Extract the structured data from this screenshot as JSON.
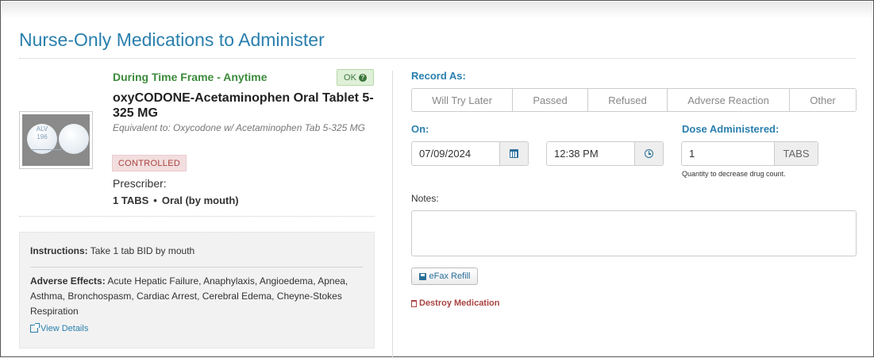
{
  "page": {
    "title": "Nurse-Only Medications to Administer"
  },
  "medication": {
    "image_alt": "pill-image",
    "pill_imprint": "ALV 196",
    "time_frame": "During Time Frame - Anytime",
    "status_badge": "OK",
    "name": "oxyCODONE-Acetaminophen Oral Tablet 5-325 MG",
    "equivalent": "Equivalent to: Oxycodone w/ Acetaminophen Tab 5-325 MG",
    "controlled_label": "CONTROLLED",
    "prescriber_label": "Prescriber:",
    "dose_qty": "1 TABS",
    "dose_separator": "•",
    "route": "Oral (by mouth)"
  },
  "instructions": {
    "label": "Instructions:",
    "text": "Take 1 tab BID by mouth",
    "adverse_label": "Adverse Effects:",
    "adverse_text": "Acute Hepatic Failure, Anaphylaxis, Angioedema, Apnea, Asthma, Bronchospasm, Cardiac Arrest, Cerebral Edema, Cheyne-Stokes Respiration",
    "view_details": "View Details"
  },
  "record": {
    "label": "Record As:",
    "options": [
      "Will Try Later",
      "Passed",
      "Refused",
      "Adverse Reaction",
      "Other"
    ]
  },
  "on": {
    "label": "On:",
    "date": "07/09/2024",
    "time": "12:38 PM"
  },
  "dose": {
    "label": "Dose Administered:",
    "value": "1",
    "unit": "TABS",
    "help": "Quantity to decrease drug count."
  },
  "notes": {
    "label": "Notes:",
    "value": ""
  },
  "actions": {
    "efax": "eFax Refill",
    "destroy": "Destroy Medication"
  },
  "colors": {
    "title_blue": "#2a7fae",
    "timeframe_green": "#3c8b3c",
    "destroy_red": "#a94442"
  }
}
